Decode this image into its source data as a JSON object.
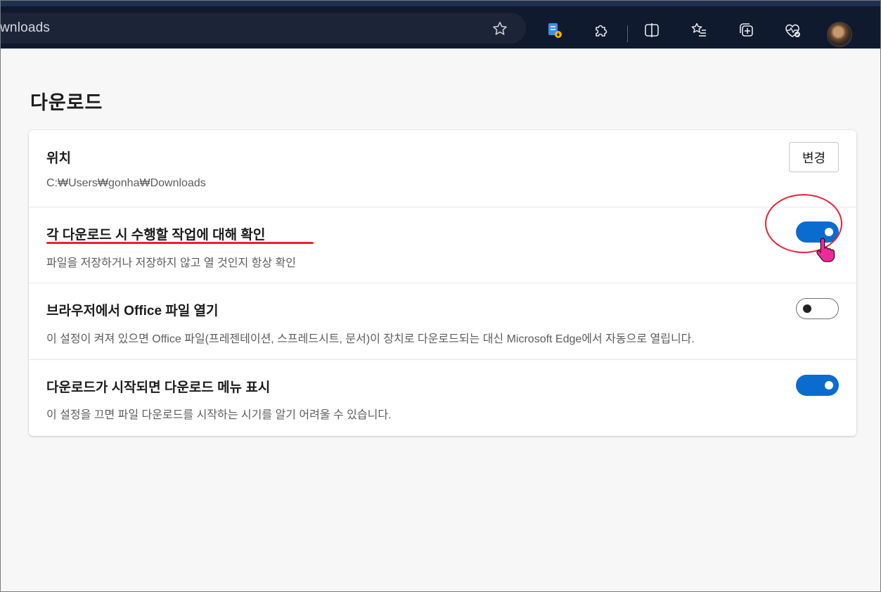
{
  "browser": {
    "address_text": "wnloads",
    "toolbar_icons": [
      "favorites-star-icon",
      "collections-cloud-icon",
      "extensions-icon",
      "split-screen-icon",
      "favorites-icon",
      "collections-icon",
      "browser-essentials-icon",
      "profile-avatar"
    ]
  },
  "page": {
    "title": "다운로드"
  },
  "settings": {
    "location": {
      "title": "위치",
      "path": "C:₩Users₩gonha₩Downloads",
      "change_label": "변경"
    },
    "ask_each": {
      "title": "각 다운로드 시 수행할 작업에 대해 확인",
      "desc": "파일을 저장하거나 저장하지 않고 열 것인지 항상 확인",
      "enabled": true
    },
    "office": {
      "title": "브라우저에서 Office 파일 열기",
      "desc": "이 설정이 켜져 있으면 Office 파일(프레젠테이션, 스프레드시트, 문서)이 장치로 다운로드되는 대신 Microsoft Edge에서 자동으로 열립니다.",
      "enabled": false
    },
    "menu": {
      "title": "다운로드가 시작되면 다운로드 메뉴 표시",
      "desc": "이 설정을 끄면 파일 다운로드를 시작하는 시기를 알기 어려울 수 있습니다.",
      "enabled": true
    }
  },
  "colors": {
    "accent": "#0b6cd0",
    "annotation": "#e52334"
  }
}
